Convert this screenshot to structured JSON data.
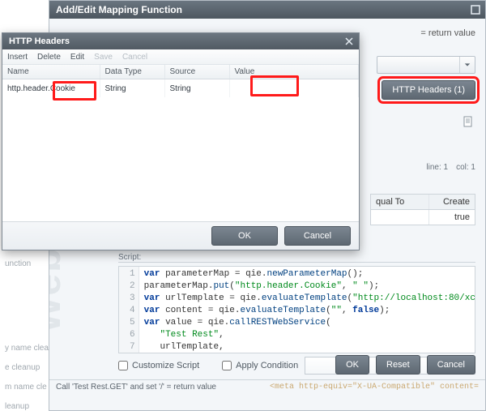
{
  "main_dialog": {
    "title": "Add/Edit Mapping Function",
    "return_value_label": "= return value",
    "http_headers_button": "HTTP Headers (1)",
    "status": {
      "line": "line: 1",
      "col": "col: 1"
    },
    "eq_table": {
      "hdr1": "qual To",
      "hdr2": "Create",
      "val2": "true"
    },
    "script_label": "Script:",
    "code": {
      "lines": [
        "var parameterMap = qie.newParameterMap();",
        "parameterMap.put(\"http.header.Cookie\", \" \");",
        "var urlTemplate = qie.evaluateTemplate(\"http://localhost:80/xc",
        "var content = qie.evaluateTemplate(\"\", false);",
        "var value = qie.callRESTWebService(",
        "   \"Test Rest\",",
        "   urlTemplate,"
      ]
    },
    "customize_script": "Customize Script",
    "apply_condition": "Apply Condition",
    "ok": "OK",
    "reset": "Reset",
    "cancel": "Cancel",
    "footer_desc": "Call 'Test Rest.GET' and set '/' = return value",
    "footer_meta": "<meta http-equiv=\"X-UA-Compatible\" content="
  },
  "left_items": {
    "a": "unction",
    "b": "y name cleanup",
    "c": "e cleanup",
    "d": "m name cle",
    "e": "leanup"
  },
  "hh_dialog": {
    "title": "HTTP Headers",
    "toolbar": {
      "insert": "Insert",
      "delete": "Delete",
      "edit": "Edit",
      "save": "Save",
      "cancel": "Cancel"
    },
    "columns": {
      "name": "Name",
      "data_type": "Data Type",
      "source": "Source",
      "value": "Value"
    },
    "row": {
      "name": "http.header.Cookie",
      "data_type": "String",
      "source": "String",
      "value": ""
    },
    "ok": "OK",
    "cancel": "Cancel"
  },
  "watermark": "Web"
}
